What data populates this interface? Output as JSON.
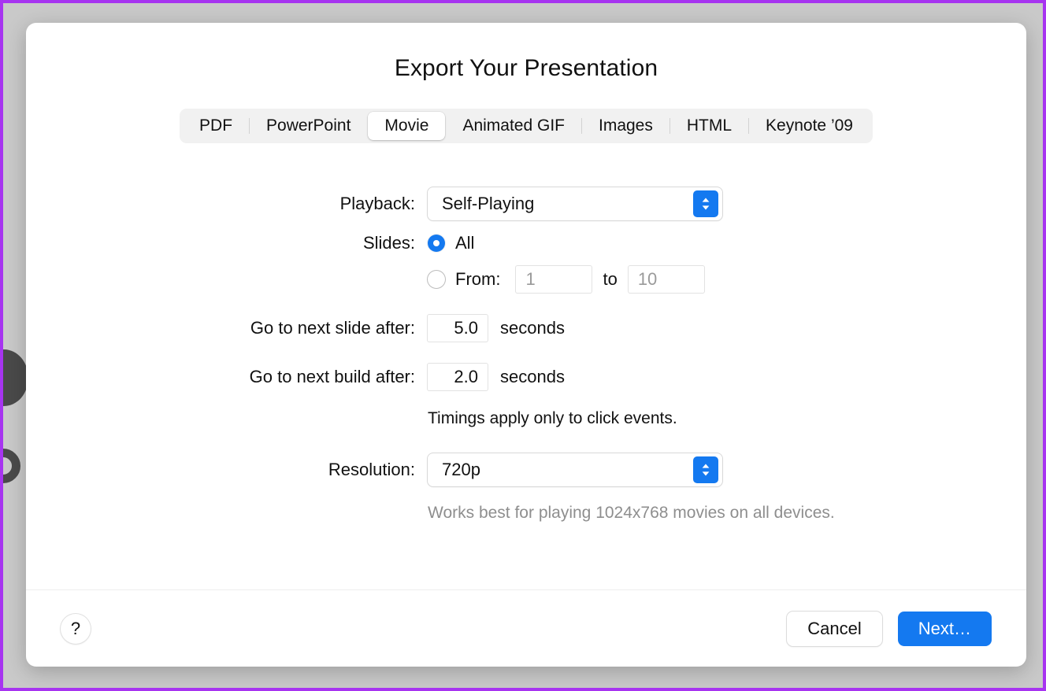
{
  "dialog": {
    "title": "Export Your Presentation"
  },
  "tabs": [
    {
      "label": "PDF",
      "selected": false
    },
    {
      "label": "PowerPoint",
      "selected": false
    },
    {
      "label": "Movie",
      "selected": true
    },
    {
      "label": "Animated GIF",
      "selected": false
    },
    {
      "label": "Images",
      "selected": false
    },
    {
      "label": "HTML",
      "selected": false
    },
    {
      "label": "Keynote ’09",
      "selected": false
    }
  ],
  "form": {
    "playback": {
      "label": "Playback:",
      "value": "Self-Playing"
    },
    "slides": {
      "label": "Slides:",
      "all_label": "All",
      "all_selected": true,
      "from_label": "From:",
      "from_selected": false,
      "from_value": "1",
      "to_word": "to",
      "to_value": "10"
    },
    "next_slide": {
      "label": "Go to next slide after:",
      "value": "5.0",
      "unit": "seconds"
    },
    "next_build": {
      "label": "Go to next build after:",
      "value": "2.0",
      "unit": "seconds"
    },
    "timings_note": "Timings apply only to click events.",
    "resolution": {
      "label": "Resolution:",
      "value": "720p",
      "note": "Works best for playing 1024x768 movies on all devices."
    }
  },
  "footer": {
    "help_label": "?",
    "cancel_label": "Cancel",
    "next_label": "Next…"
  },
  "colors": {
    "accent": "#1479f0",
    "border": "#a734f0",
    "backdrop": "#c9c9c9"
  }
}
